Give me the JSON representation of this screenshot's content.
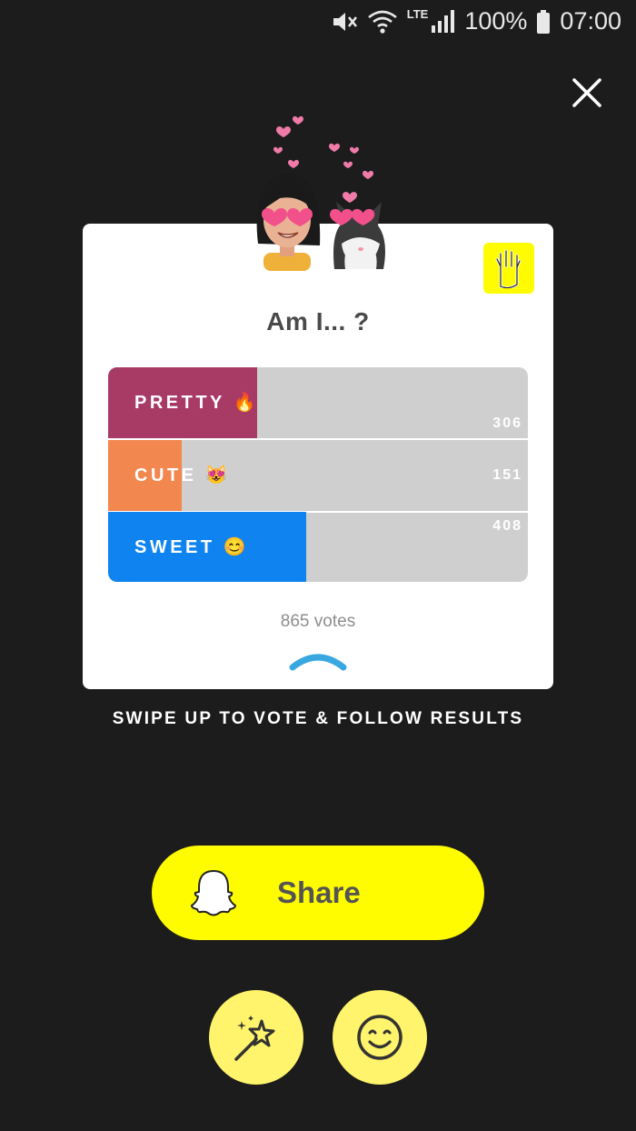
{
  "status_bar": {
    "battery": "100%",
    "time": "07:00",
    "network": "LTE"
  },
  "poll": {
    "question": "Am I... ?",
    "options": [
      {
        "label": "PRETTY 🔥",
        "count": "306",
        "fraction": 0.354,
        "color": "#a83a66"
      },
      {
        "label": "CUTE 😻",
        "count": "151",
        "fraction": 0.175,
        "color": "#f2874f"
      },
      {
        "label": "SWEET 😊",
        "count": "408",
        "fraction": 0.472,
        "color": "#0f84f0"
      }
    ],
    "votes": "865 votes"
  },
  "swipe_hint": "SWIPE UP TO VOTE & FOLLOW RESULTS",
  "share": {
    "label": "Share"
  },
  "colors": {
    "background": "#1c1c1c",
    "accent": "#fffc00",
    "bar_bg": "#cfcfcf"
  }
}
